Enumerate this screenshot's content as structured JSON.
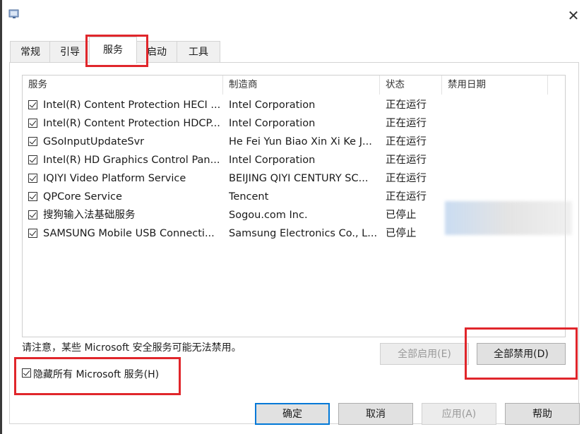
{
  "window": {
    "icon": "msconfig-icon",
    "close_glyph": "✕"
  },
  "tabs": [
    {
      "label": "常规"
    },
    {
      "label": "引导"
    },
    {
      "label": "服务"
    },
    {
      "label": "启动"
    },
    {
      "label": "工具"
    }
  ],
  "columns": [
    "服务",
    "制造商",
    "状态",
    "禁用日期"
  ],
  "services": [
    {
      "name": "Intel(R) Content Protection HECI ...",
      "maker": "Intel Corporation",
      "status": "正在运行",
      "checked": true
    },
    {
      "name": "Intel(R) Content Protection HDCP...",
      "maker": "Intel Corporation",
      "status": "正在运行",
      "checked": true
    },
    {
      "name": "GSoInputUpdateSvr",
      "maker": "He Fei Yun Biao Xin Xi Ke J...",
      "status": "正在运行",
      "checked": true
    },
    {
      "name": "Intel(R) HD Graphics Control Pan...",
      "maker": "Intel Corporation",
      "status": "正在运行",
      "checked": true
    },
    {
      "name": "IQIYI Video Platform Service",
      "maker": "BEIJING QIYI CENTURY SC...",
      "status": "正在运行",
      "checked": true
    },
    {
      "name": "QPCore Service",
      "maker": "Tencent",
      "status": "正在运行",
      "checked": true
    },
    {
      "name": "搜狗输入法基础服务",
      "maker": "Sogou.com Inc.",
      "status": "已停止",
      "checked": true
    },
    {
      "name": "SAMSUNG Mobile USB Connecti...",
      "maker": "Samsung Electronics Co., L...",
      "status": "已停止",
      "checked": true
    }
  ],
  "note": "请注意，某些 Microsoft 安全服务可能无法禁用。",
  "buttons": {
    "enable_all": "全部启用(E)",
    "disable_all": "全部禁用(D)",
    "ok": "确定",
    "cancel": "取消",
    "apply": "应用(A)",
    "help": "帮助"
  },
  "hide_ms": {
    "label": "隐藏所有 Microsoft 服务(H)",
    "checked": true
  },
  "colors": {
    "highlight": "#e0262b",
    "default_button_border": "#0078d7"
  }
}
